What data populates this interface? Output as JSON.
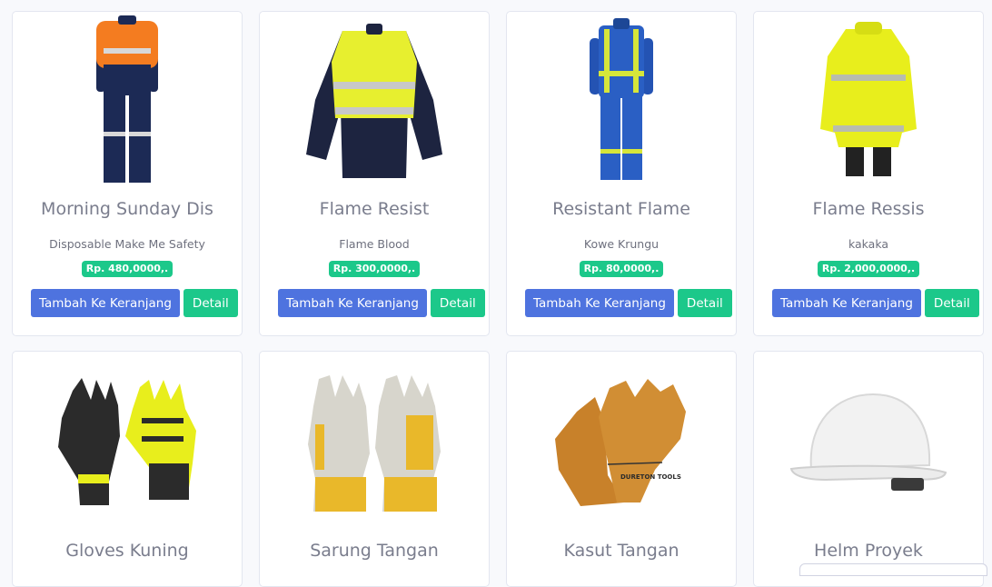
{
  "products": [
    {
      "name": "Morning Sunday Dis",
      "desc": "Disposable Make Me Safety",
      "price": "Rp. 480,0000,.",
      "cart_label": "Tambah Ke Keranjang",
      "detail_label": "Detail",
      "image": "coverall-orange-navy"
    },
    {
      "name": "Flame Resist",
      "desc": "Flame Blood",
      "price": "Rp. 300,0000,.",
      "cart_label": "Tambah Ke Keranjang",
      "detail_label": "Detail",
      "image": "shirt-yellow-navy"
    },
    {
      "name": "Resistant Flame",
      "desc": "Kowe Krungu",
      "price": "Rp. 80,0000,.",
      "cart_label": "Tambah Ke Keranjang",
      "detail_label": "Detail",
      "image": "coverall-blue"
    },
    {
      "name": "Flame Ressis",
      "desc": "kakaka",
      "price": "Rp. 2,000,0000,.",
      "cart_label": "Tambah Ke Keranjang",
      "detail_label": "Detail",
      "image": "raincoat-yellow"
    },
    {
      "name": "Gloves Kuning",
      "image": "gloves-impact"
    },
    {
      "name": "Sarung Tangan",
      "image": "gloves-leather-yellow"
    },
    {
      "name": "Kasut Tangan",
      "image": "gloves-welding",
      "image_text": "DURETON TOOLS"
    },
    {
      "name": "Helm Proyek",
      "image": "helmet-white"
    }
  ],
  "colors": {
    "primary": "#4e73df",
    "success": "#1cc88a",
    "title_text": "#7a7d8d",
    "background": "#f8f9fc"
  }
}
